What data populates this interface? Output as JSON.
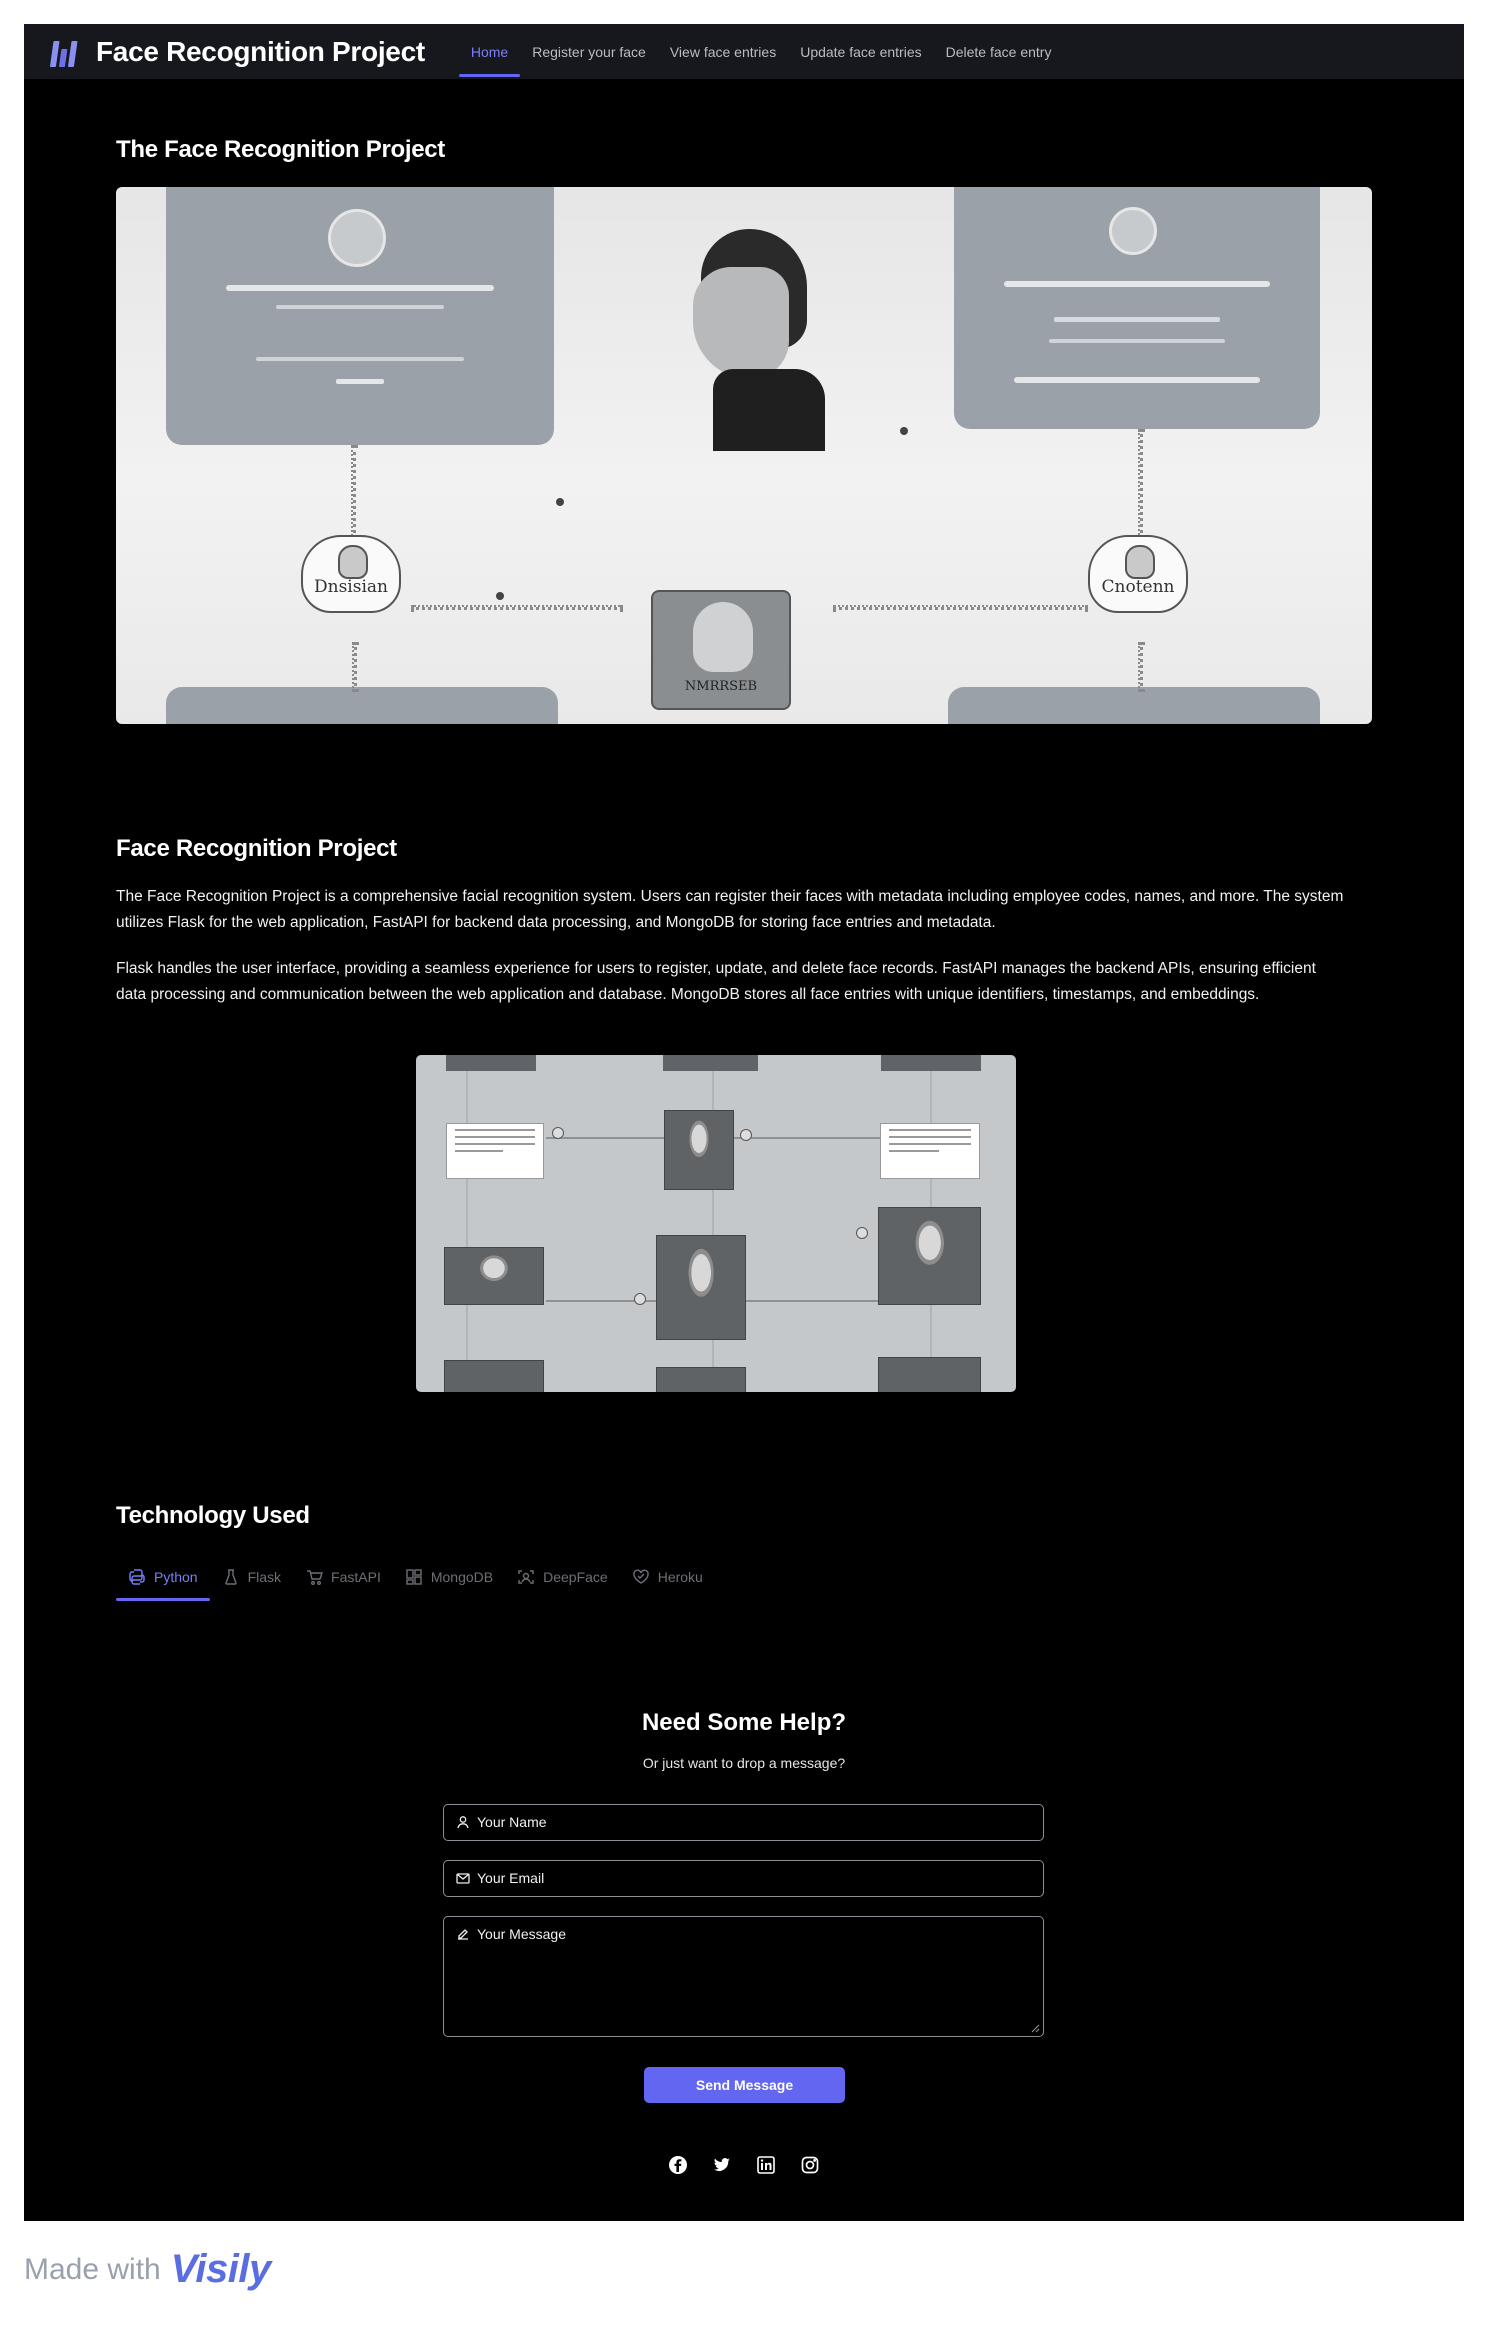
{
  "nav": {
    "brand": "Face Recognition Project",
    "links": [
      "Home",
      "Register your face",
      "View face entries",
      "Update face entries",
      "Delete face entry"
    ]
  },
  "hero": {
    "title": "The Face Recognition Project",
    "labels": {
      "left_node": "Dnsisian",
      "right_node": "Cnotenn",
      "bottom_tag": "NMRRSEB"
    }
  },
  "about": {
    "title": "Face Recognition Project",
    "p1": "The Face Recognition Project is a comprehensive facial recognition system. Users can register their faces with metadata including employee codes, names, and more. The system utilizes Flask for the web application, FastAPI for backend data processing, and MongoDB for storing face entries and metadata.",
    "p2": "Flask handles the user interface, providing a seamless experience for users to register, update, and delete face records. FastAPI manages the backend APIs, ensuring efficient data processing and communication between the web application and database. MongoDB stores all face entries with unique identifiers, timestamps, and embeddings."
  },
  "tech": {
    "title": "Technology Used",
    "tabs": [
      "Python",
      "Flask",
      "FastAPI",
      "MongoDB",
      "DeepFace",
      "Heroku"
    ]
  },
  "help": {
    "title": "Need Some Help?",
    "subtitle": "Or just want to drop a message?",
    "name_placeholder": "Your Name",
    "email_placeholder": "Your Email",
    "message_placeholder": "Your Message",
    "send_label": "Send Message"
  },
  "socials": [
    "facebook-icon",
    "twitter-icon",
    "linkedin-icon",
    "instagram-icon"
  ],
  "footer": {
    "made_with": "Made with",
    "brand": "Visily"
  },
  "colors": {
    "accent": "#6366f1",
    "nav_bg": "#16181d",
    "page_bg": "#000000"
  }
}
